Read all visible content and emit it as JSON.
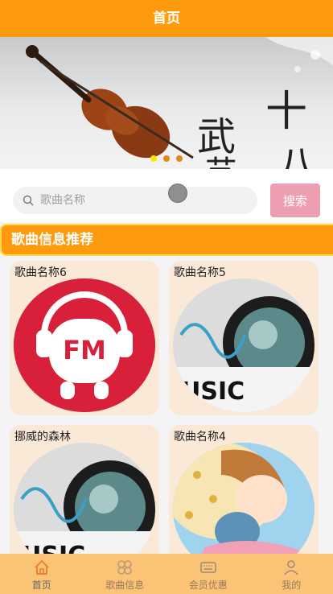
{
  "header": {
    "title": "首页"
  },
  "banner": {
    "dots": 3,
    "active_dot": 0,
    "calligraphy": [
      "武",
      "十",
      "艺",
      "八"
    ]
  },
  "search": {
    "placeholder": "歌曲名称",
    "button_label": "搜索"
  },
  "section": {
    "title": "歌曲信息推荐"
  },
  "cards": [
    {
      "title": "歌曲名称6",
      "image": "fm-radio-logo"
    },
    {
      "title": "歌曲名称5",
      "image": "music-speaker-art"
    },
    {
      "title": "挪威的森林",
      "image": "music-speaker-art"
    },
    {
      "title": "歌曲名称4",
      "image": "sleeping-girl-with-bear"
    }
  ],
  "tabbar": {
    "items": [
      {
        "label": "首页",
        "icon": "home-icon"
      },
      {
        "label": "歌曲信息",
        "icon": "grid-icon"
      },
      {
        "label": "会员优惠",
        "icon": "keyboard-icon"
      },
      {
        "label": "我的",
        "icon": "user-icon"
      }
    ]
  },
  "colors": {
    "accent": "#fd9a0e",
    "search_button": "#ee9eb1",
    "card_bg": "#fbe9d8",
    "tabbar": "#fbc376"
  }
}
